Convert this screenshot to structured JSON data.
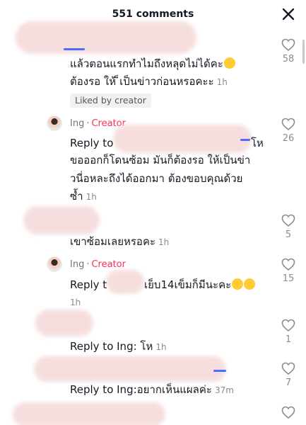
{
  "header": {
    "title": "551 comments"
  },
  "comments": [
    {
      "line1": "แล้วตอนแรกทำไมถึงหลุดไม่ได้คะ",
      "line2": "ต้องรอ ให้ ็เป็นข่าวก่อนหรอคะะ",
      "time": "1h",
      "badge": "Liked by creator",
      "likes": "58"
    },
    {
      "author": "Ing",
      "role": "Creator",
      "line1a": "Reply to",
      "line1b": "โห",
      "line2": "ขอออกก็โดนซ้อม มันก็ต้องรอ ให้เป็นข่า",
      "line3": "วนี่อหละถึงได้ออกมา ต้องขอบคุณด้วย",
      "line4": "ซ้ำ",
      "time": "1h",
      "likes": "26"
    },
    {
      "text": "เขาซ้อมเลยหรอคะ",
      "time": "1h",
      "likes": "5"
    },
    {
      "author": "Ing",
      "role": "Creator",
      "line1a": "Reply t",
      "line1b": "เย็บ14เข็มก็มีนะคะ",
      "time": "1h",
      "likes": "15"
    },
    {
      "text": "Reply to Ing: โห",
      "time": "1h",
      "likes": "1"
    },
    {
      "text": "Reply to Ing:อยากเห็นแผลค่ะ",
      "time": "37m",
      "likes": "7"
    }
  ],
  "icons": {
    "like": "heart-outline-icon",
    "close": "close-icon"
  },
  "colors": {
    "creator": "#fe2c55",
    "muted": "#8a8b91",
    "text": "#161823"
  }
}
